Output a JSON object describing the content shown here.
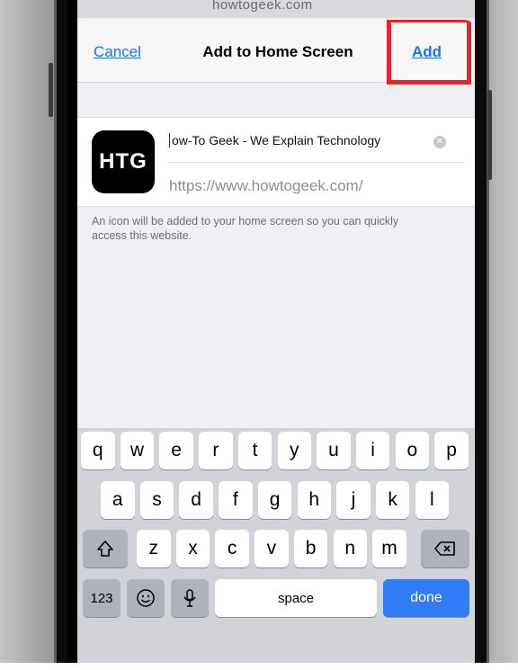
{
  "header": {
    "peek_url": "howtogeek.com",
    "cancel_label": "Cancel",
    "title": "Add to Home Screen",
    "add_label": "Add"
  },
  "app": {
    "icon_text": "HTG",
    "name_value": "ow-To Geek - We Explain Technology",
    "url": "https://www.howtogeek.com/",
    "note": "An icon will be added to your home screen so you can quickly access this website."
  },
  "keyboard": {
    "row1": [
      "q",
      "w",
      "e",
      "r",
      "t",
      "y",
      "u",
      "i",
      "o",
      "p"
    ],
    "row2": [
      "a",
      "s",
      "d",
      "f",
      "g",
      "h",
      "j",
      "k",
      "l"
    ],
    "row3": [
      "z",
      "x",
      "c",
      "v",
      "b",
      "n",
      "m"
    ],
    "numbers_label": "123",
    "space_label": "space",
    "done_label": "done"
  },
  "colors": {
    "accent": "#1a73e8",
    "highlight": "#e8232a",
    "done_key": "#2f7cf6"
  }
}
